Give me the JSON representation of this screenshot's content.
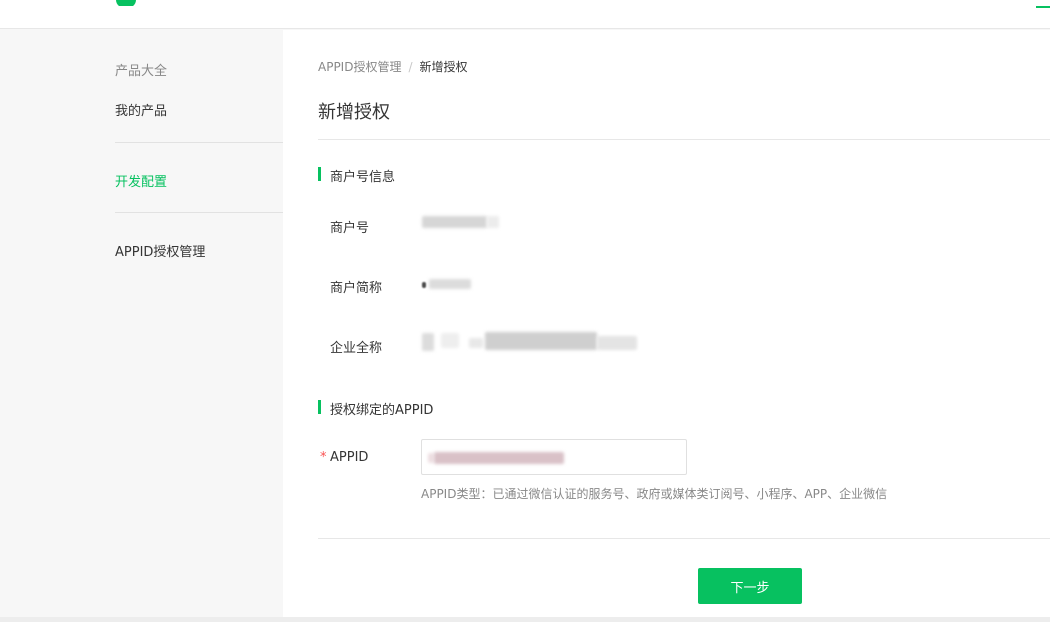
{
  "colors": {
    "accent": "#07c160",
    "required": "#fa5151",
    "muted": "#888888",
    "text": "#353535"
  },
  "logo": {
    "icon": "wechat-pay-logo-icon"
  },
  "sidebar": {
    "group_title": "产品大全",
    "items": [
      {
        "label": "我的产品",
        "active": false
      },
      {
        "label": "开发配置",
        "active": true
      },
      {
        "label": "APPID授权管理",
        "active": false
      }
    ]
  },
  "breadcrumb": {
    "parent": "APPID授权管理",
    "separator": "/",
    "current": "新增授权"
  },
  "page": {
    "title": "新增授权"
  },
  "merchant_section": {
    "title": "商户号信息",
    "fields": [
      {
        "label": "商户号"
      },
      {
        "label": "商户简称"
      },
      {
        "label": "企业全称"
      }
    ]
  },
  "appid_section": {
    "title": "授权绑定的APPID",
    "field": {
      "required_mark": "*",
      "label": "APPID"
    },
    "hint": "APPID类型：已通过微信认证的服务号、政府或媒体类订阅号、小程序、APP、企业微信"
  },
  "actions": {
    "next_label": "下一步"
  }
}
